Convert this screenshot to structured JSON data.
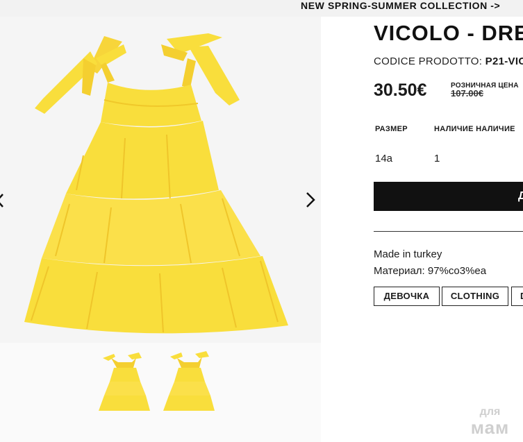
{
  "banner": {
    "text": "NEW SPRING-SUMMER COLLECTION ->"
  },
  "gallery": {
    "main_image": "yellow-tiered-dress",
    "prev_icon": "chevron-left-icon",
    "next_icon": "chevron-right-icon",
    "thumbnails": [
      "dress-thumbnail-1",
      "dress-thumbnail-2"
    ]
  },
  "product": {
    "title": "VICOLO - DRE",
    "code_label": "CODICE PRODOTTO:",
    "code_value": "P21-VIC",
    "price": "30.50€",
    "retail_label": "РОЗНИЧНАЯ ЦЕНА",
    "old_price": "107.00€"
  },
  "table": {
    "headers": {
      "size": "РАЗМЕР",
      "availability": "НАЛИЧИЕ НАЛИЧИЕ"
    },
    "rows": [
      {
        "size": "14a",
        "availability": "1"
      }
    ]
  },
  "add_button": {
    "label": "Д"
  },
  "details": {
    "made_in": "Made in turkey",
    "material": "Материал: 97%co3%ea"
  },
  "tags": [
    "ДЕВОЧКА",
    "CLOTHING",
    "D"
  ],
  "watermark": {
    "line1": "для",
    "line2": "мам"
  },
  "colors": {
    "dress": "#f9de3c",
    "background": "#f5f5f5",
    "button": "#111111"
  }
}
